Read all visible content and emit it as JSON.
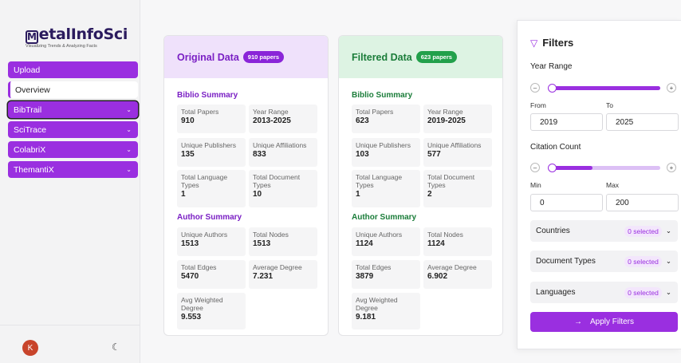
{
  "logo": {
    "text": "etalInfoSci",
    "subtitle": "Visualizing Trends & Analyzing Facts"
  },
  "sidebar": {
    "items": [
      {
        "label": "Upload",
        "chevron": false
      },
      {
        "label": "Overview",
        "chevron": false
      },
      {
        "label": "BibTrail",
        "chevron": true
      },
      {
        "label": "SciTrace",
        "chevron": true
      },
      {
        "label": "ColabriX",
        "chevron": true
      },
      {
        "label": "ThemantiX",
        "chevron": true
      }
    ],
    "avatar": "K"
  },
  "original": {
    "title": "Original Data",
    "badge": "910 papers",
    "biblio_title": "Biblio Summary",
    "biblio": [
      {
        "label": "Total Papers",
        "value": "910"
      },
      {
        "label": "Year Range",
        "value": "2013-2025"
      },
      {
        "label": "Unique Publishers",
        "value": "135"
      },
      {
        "label": "Unique Affiliations",
        "value": "833"
      },
      {
        "label": "Total Language Types",
        "value": "1"
      },
      {
        "label": "Total Document Types",
        "value": "10"
      }
    ],
    "author_title": "Author Summary",
    "author": [
      {
        "label": "Unique Authors",
        "value": "1513"
      },
      {
        "label": "Total Nodes",
        "value": "1513"
      },
      {
        "label": "Total Edges",
        "value": "5470"
      },
      {
        "label": "Average Degree",
        "value": "7.231"
      },
      {
        "label": "Avg Weighted Degree",
        "value": "9.553"
      }
    ]
  },
  "filtered": {
    "title": "Filtered Data",
    "badge": "623 papers",
    "biblio_title": "Biblio Summary",
    "biblio": [
      {
        "label": "Total Papers",
        "value": "623"
      },
      {
        "label": "Year Range",
        "value": "2019-2025"
      },
      {
        "label": "Unique Publishers",
        "value": "103"
      },
      {
        "label": "Unique Affiliations",
        "value": "577"
      },
      {
        "label": "Total Language Types",
        "value": "1"
      },
      {
        "label": "Total Document Types",
        "value": "2"
      }
    ],
    "author_title": "Author Summary",
    "author": [
      {
        "label": "Unique Authors",
        "value": "1124"
      },
      {
        "label": "Total Nodes",
        "value": "1124"
      },
      {
        "label": "Total Edges",
        "value": "3879"
      },
      {
        "label": "Average Degree",
        "value": "6.902"
      },
      {
        "label": "Avg Weighted Degree",
        "value": "9.181"
      }
    ]
  },
  "filters": {
    "title": "Filters",
    "year_range": {
      "label": "Year Range",
      "from_label": "From",
      "to_label": "To",
      "from": "2019",
      "to": "2025"
    },
    "citation": {
      "label": "Citation Count",
      "min_label": "Min",
      "max_label": "Max",
      "min": "0",
      "max": "200"
    },
    "dropdowns": [
      {
        "label": "Countries",
        "count": "0 selected"
      },
      {
        "label": "Document Types",
        "count": "0 selected"
      },
      {
        "label": "Languages",
        "count": "0 selected"
      }
    ],
    "apply_label": "Apply Filters"
  },
  "colors": {
    "accent": "#9a2fe0",
    "green": "#22a04b",
    "avatar": "#c8442b"
  }
}
